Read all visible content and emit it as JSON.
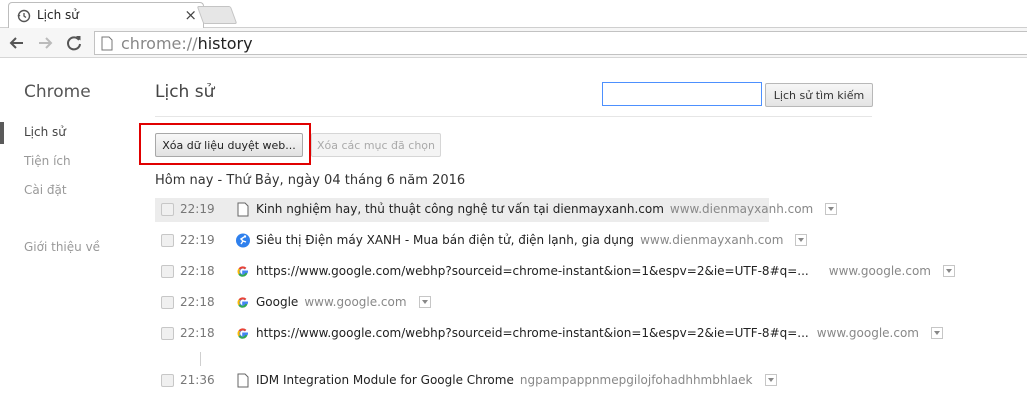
{
  "browser": {
    "tab_title": "Lịch sử",
    "url_scheme": "chrome://",
    "url_host": "history"
  },
  "sidebar": {
    "title": "Chrome",
    "items": [
      {
        "label": "Lịch sử",
        "active": true
      },
      {
        "label": "Tiện ích",
        "active": false
      },
      {
        "label": "Cài đặt",
        "active": false
      },
      {
        "label": "Giới thiệu về",
        "active": false
      }
    ]
  },
  "main": {
    "title": "Lịch sử",
    "search_placeholder": "",
    "search_value": "",
    "search_button": "Lịch sử tìm kiếm",
    "clear_button": "Xóa dữ liệu duyệt web...",
    "remove_button": "Xóa các mục đã chọn",
    "day_heading": "Hôm nay - Thứ Bảy, ngày 04 tháng 6 năm 2016",
    "entries": [
      {
        "time": "22:19",
        "title": "Kinh nghiệm hay, thủ thuật công nghệ tư vấn tại dienmayxanh.com",
        "domain": "www.dienmayxanh.com",
        "icon": "page-icon"
      },
      {
        "time": "22:19",
        "title": "Siêu thị Điện máy XANH - Mua bán điện tử, điện lạnh, gia dụng",
        "domain": "www.dienmayxanh.com",
        "icon": "dienmayxanh-icon"
      },
      {
        "time": "22:18",
        "title": "https://www.google.com/webhp?sourceid=chrome-instant&ion=1&espv=2&ie=UTF-8#q=...",
        "domain": "www.google.com",
        "icon": "google-icon"
      },
      {
        "time": "22:18",
        "title": "Google",
        "domain": "www.google.com",
        "icon": "google-icon"
      },
      {
        "time": "22:18",
        "title": "https://www.google.com/webhp?sourceid=chrome-instant&ion=1&espv=2&ie=UTF-8#q=...",
        "domain": "www.google.com",
        "icon": "google-icon"
      },
      {
        "time": "21:36",
        "title": "IDM Integration Module for Google Chrome",
        "domain": "ngpampappnmepgilojfohadhhmbhlaek",
        "icon": "page-icon"
      }
    ]
  },
  "colors": {
    "highlight": "#e00000",
    "search_focus": "#4d90fe"
  }
}
